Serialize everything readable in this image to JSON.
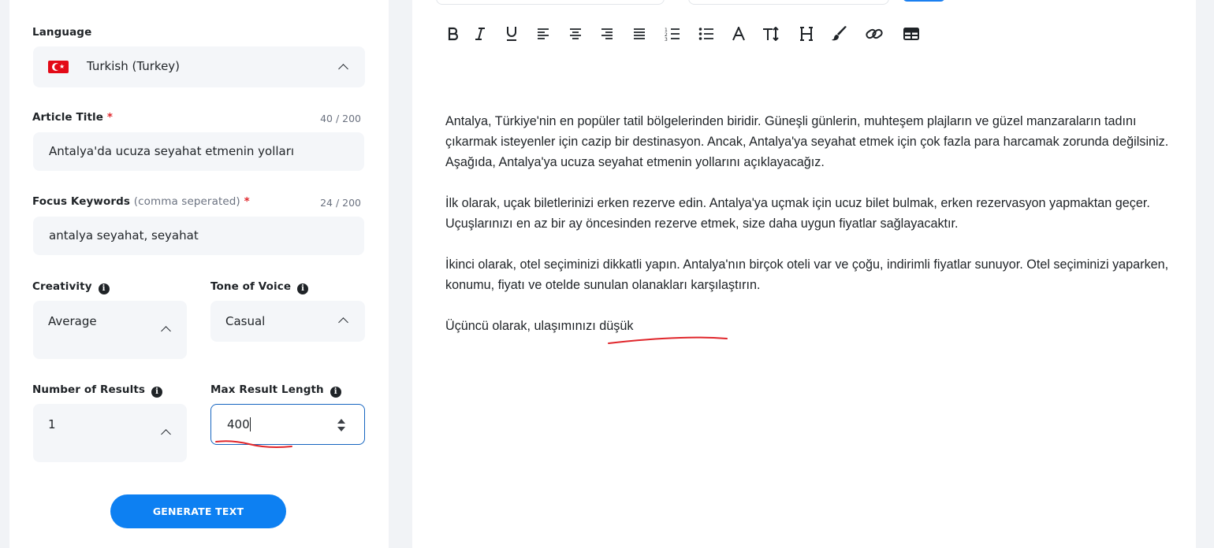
{
  "form": {
    "language": {
      "label": "Language",
      "value": "Turkish (Turkey)",
      "flag": "tr-flag-icon"
    },
    "article_title": {
      "label": "Article Title",
      "required_mark": "*",
      "counter": "40 / 200",
      "value": "Antalya'da ucuza seyahat etmenin yolları"
    },
    "focus_keywords": {
      "label": "Focus Keywords",
      "hint": "(comma seperated)",
      "required_mark": "*",
      "counter": "24 / 200",
      "value": "antalya seyahat, seyahat"
    },
    "creativity": {
      "label": "Creativity",
      "value": "Average"
    },
    "tone_of_voice": {
      "label": "Tone of Voice",
      "value": "Casual"
    },
    "number_of_results": {
      "label": "Number of Results",
      "value": "1"
    },
    "max_result_length": {
      "label": "Max Result Length",
      "value": "400"
    },
    "generate_button": "GENERATE TEXT"
  },
  "editor": {
    "paragraphs": [
      "Antalya, Türkiye'nin en popüler tatil bölgelerinden biridir. Güneşli günlerin, muhteşem plajların ve güzel manzaraların tadını çıkarmak isteyenler için cazip bir destinasyon. Ancak, Antalya'ya seyahat etmek için çok fazla para harcamak zorunda değilsiniz. Aşağıda, Antalya'ya ucuza seyahat etmenin yollarını açıklayacağız.",
      "İlk olarak, uçak biletlerinizi erken rezerve edin. Antalya'ya uçmak için ucuz bilet bulmak, erken rezervasyon yapmaktan geçer. Uçuşlarınızı en az bir ay öncesinden rezerve etmek, size daha uygun fiyatlar sağlayacaktır.",
      "İkinci olarak, otel seçiminizi dikkatli yapın. Antalya'nın birçok oteli var ve çoğu, indirimli fiyatlar sunuyor. Otel seçiminizi yaparken, konumu, fiyatı ve otelde sunulan olanakları karşılaştırın.",
      "Üçüncü olarak, ulaşımınızı düşük"
    ]
  },
  "colors": {
    "accent": "#0d80f2",
    "required": "#e0262b",
    "annotation": "#e0262b"
  }
}
